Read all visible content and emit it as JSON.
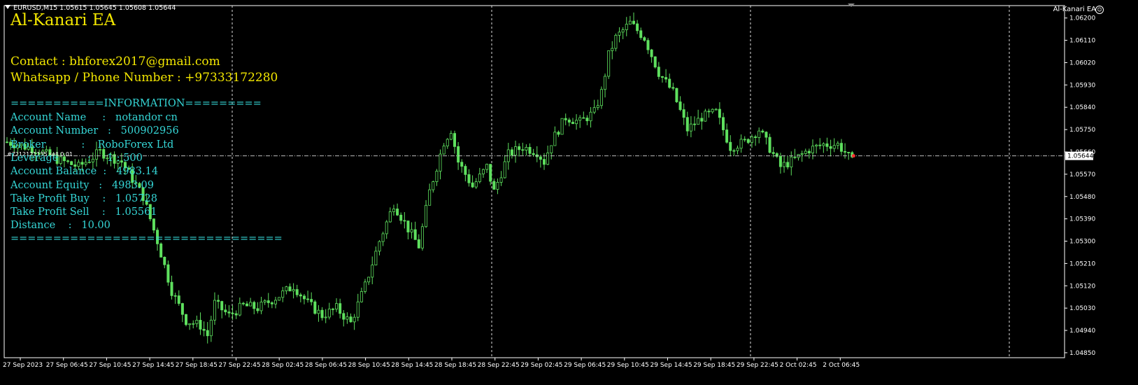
{
  "header": {
    "symbol_line": "EURUSD,M15  1.05615 1.05645 1.05608 1.05644",
    "ea_indicator": "Al-Kanari EA",
    "trade_label": "#7212121135 sell 0.01"
  },
  "overlay": {
    "title": "Al-Kanari EA",
    "contact": "Contact : bhforex2017@gmail.com",
    "phone": "Whatsapp / Phone Number : +97333172280",
    "info_header": "===========INFORMATION=========",
    "rows": [
      "Account Name     :   notandor cn",
      "Account Number   :   500902956",
      "Broker           :    RoboForex Ltd",
      "Leverage         :     1 : 500",
      "Account Balance  :   4983.14",
      "Account Equity   :   4983.09",
      "Take Profit Buy    :   1.05728",
      "Take Profit Sell    :   1.05561",
      "Distance    :   10.00"
    ],
    "info_footer": "================================"
  },
  "colors": {
    "background": "#000000",
    "candle": "#5ee05e",
    "title": "#f2e600",
    "info": "#35d6d6",
    "axis": "#ffffff"
  },
  "chart_data": {
    "type": "candlestick",
    "symbol": "EURUSD",
    "timeframe": "M15",
    "current_price": 1.05644,
    "price_ticks": [
      1.062,
      1.0611,
      1.0602,
      1.0593,
      1.0584,
      1.0575,
      1.0566,
      1.0557,
      1.0548,
      1.0539,
      1.053,
      1.0521,
      1.0512,
      1.0503,
      1.0494,
      1.0485
    ],
    "time_labels": [
      "27 Sep 2023",
      "27 Sep 06:45",
      "27 Sep 10:45",
      "27 Sep 14:45",
      "27 Sep 18:45",
      "27 Sep 22:45",
      "28 Sep 02:45",
      "28 Sep 06:45",
      "28 Sep 10:45",
      "28 Sep 14:45",
      "28 Sep 18:45",
      "28 Sep 22:45",
      "29 Sep 02:45",
      "29 Sep 06:45",
      "29 Sep 10:45",
      "29 Sep 14:45",
      "29 Sep 18:45",
      "29 Sep 22:45",
      "2 Oct 02:45",
      "2 Oct 06:45"
    ],
    "ylim": [
      1.0483,
      1.0625
    ],
    "close_path": [
      [
        0,
        1.057
      ],
      [
        8,
        1.0567
      ],
      [
        14,
        1.0563
      ],
      [
        20,
        1.056
      ],
      [
        26,
        1.0566
      ],
      [
        32,
        1.0562
      ],
      [
        38,
        1.0548
      ],
      [
        42,
        1.053
      ],
      [
        46,
        1.051
      ],
      [
        50,
        1.0498
      ],
      [
        54,
        1.0496
      ],
      [
        56,
        1.0492
      ],
      [
        58,
        1.0505
      ],
      [
        62,
        1.05
      ],
      [
        66,
        1.0504
      ],
      [
        70,
        1.0503
      ],
      [
        76,
        1.0508
      ],
      [
        80,
        1.0512
      ],
      [
        84,
        1.0505
      ],
      [
        88,
        1.05
      ],
      [
        92,
        1.0503
      ],
      [
        96,
        1.0497
      ],
      [
        100,
        1.0512
      ],
      [
        104,
        1.053
      ],
      [
        108,
        1.0545
      ],
      [
        112,
        1.0535
      ],
      [
        115,
        1.0528
      ],
      [
        118,
        1.055
      ],
      [
        122,
        1.057
      ],
      [
        124,
        1.0575
      ],
      [
        126,
        1.0562
      ],
      [
        130,
        1.0552
      ],
      [
        134,
        1.056
      ],
      [
        136,
        1.055
      ],
      [
        140,
        1.0565
      ],
      [
        144,
        1.0568
      ],
      [
        148,
        1.0566
      ],
      [
        150,
        1.0562
      ],
      [
        152,
        1.057
      ],
      [
        156,
        1.058
      ],
      [
        160,
        1.0578
      ],
      [
        164,
        1.0582
      ],
      [
        166,
        1.059
      ],
      [
        168,
        1.0605
      ],
      [
        170,
        1.0612
      ],
      [
        174,
        1.0618
      ],
      [
        178,
        1.0612
      ],
      [
        182,
        1.0598
      ],
      [
        186,
        1.059
      ],
      [
        190,
        1.0575
      ],
      [
        194,
        1.058
      ],
      [
        198,
        1.0582
      ],
      [
        200,
        1.0575
      ],
      [
        202,
        1.0568
      ],
      [
        206,
        1.057
      ],
      [
        210,
        1.0575
      ],
      [
        212,
        1.057
      ],
      [
        214,
        1.0565
      ],
      [
        216,
        1.056
      ],
      [
        220,
        1.0563
      ],
      [
        224,
        1.0567
      ],
      [
        228,
        1.0569
      ],
      [
        232,
        1.0569
      ],
      [
        234,
        1.0566
      ],
      [
        236,
        1.0562
      ]
    ]
  }
}
